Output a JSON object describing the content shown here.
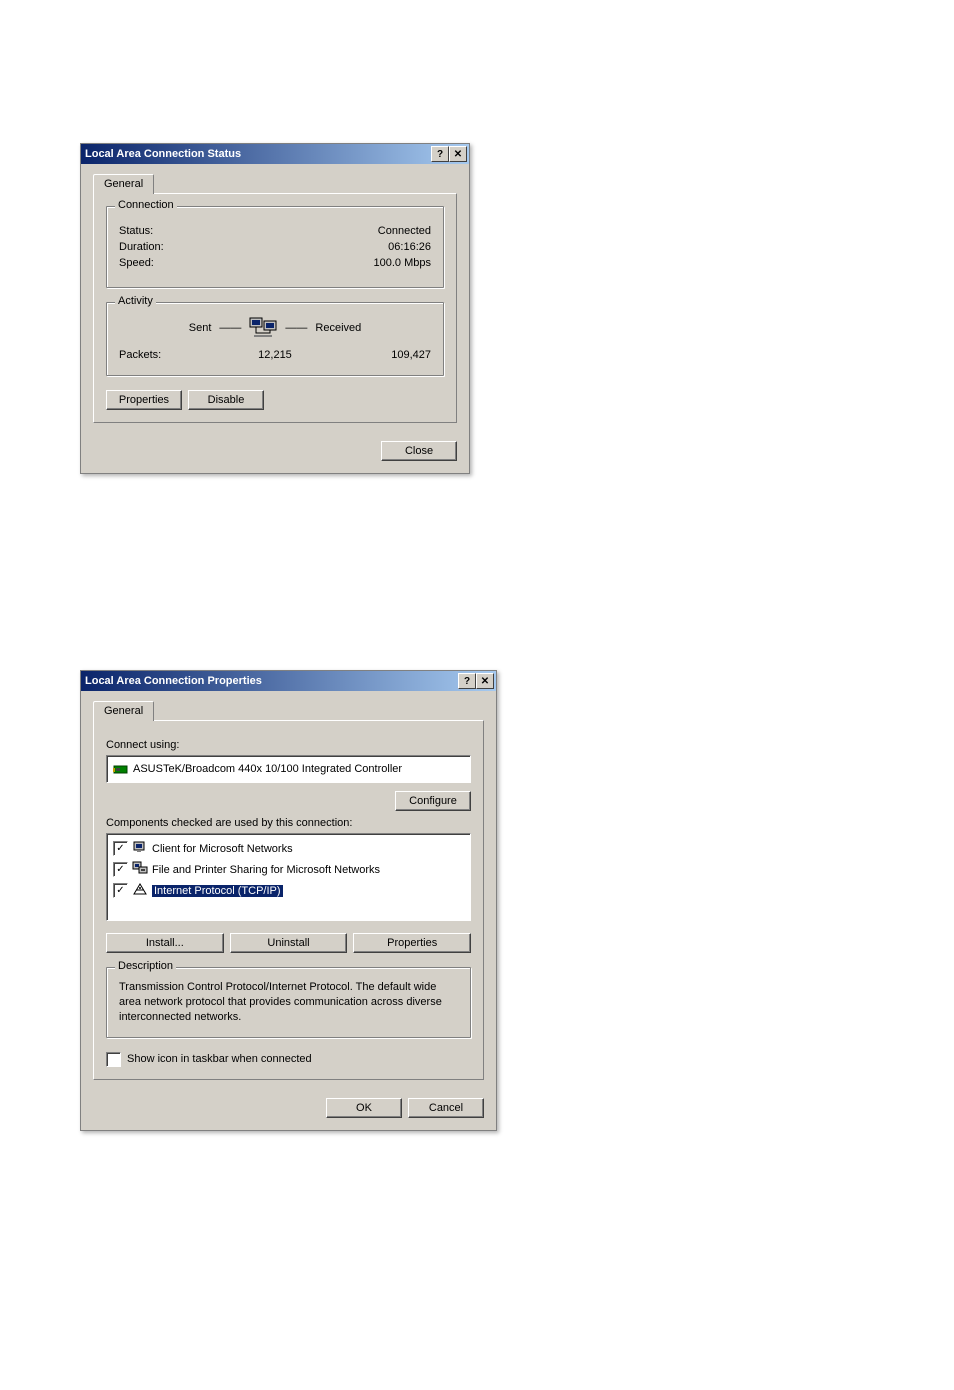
{
  "dialog1": {
    "title": "Local Area Connection Status",
    "tab": "General",
    "connection": {
      "legend": "Connection",
      "status_label": "Status:",
      "status_value": "Connected",
      "duration_label": "Duration:",
      "duration_value": "06:16:26",
      "speed_label": "Speed:",
      "speed_value": "100.0 Mbps"
    },
    "activity": {
      "legend": "Activity",
      "sent_label": "Sent",
      "received_label": "Received",
      "packets_label": "Packets:",
      "sent_value": "12,215",
      "received_value": "109,427"
    },
    "buttons": {
      "properties": "Properties",
      "disable": "Disable",
      "close": "Close"
    }
  },
  "dialog2": {
    "title": "Local Area Connection Properties",
    "tab": "General",
    "connect_using_label": "Connect using:",
    "adapter": "ASUSTeK/Broadcom 440x 10/100 Integrated Controller",
    "configure_btn": "Configure",
    "components_label": "Components checked are used by this connection:",
    "components": [
      {
        "checked": true,
        "label": "Client for Microsoft Networks",
        "selected": false
      },
      {
        "checked": true,
        "label": "File and Printer Sharing for Microsoft Networks",
        "selected": false
      },
      {
        "checked": true,
        "label": "Internet Protocol (TCP/IP)",
        "selected": true
      }
    ],
    "buttons": {
      "install": "Install...",
      "uninstall": "Uninstall",
      "properties": "Properties",
      "ok": "OK",
      "cancel": "Cancel"
    },
    "description": {
      "legend": "Description",
      "text": "Transmission Control Protocol/Internet Protocol. The default wide area network protocol that provides communication across diverse interconnected networks."
    },
    "show_icon": {
      "checked": false,
      "label": "Show icon in taskbar when connected"
    }
  }
}
